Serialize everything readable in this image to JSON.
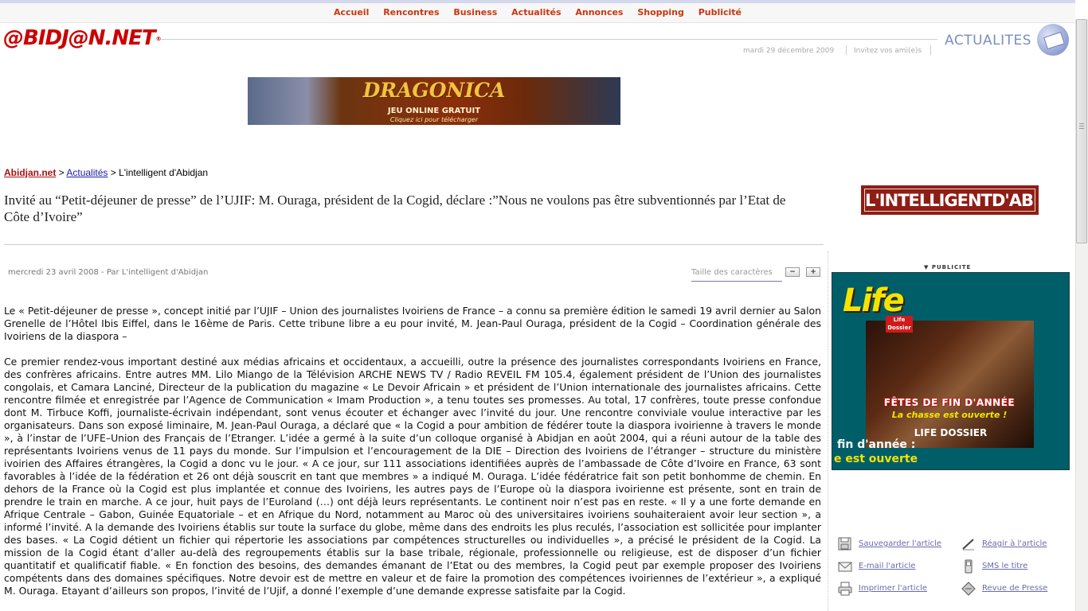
{
  "nav": {
    "items": [
      "Accueil",
      "Rencontres",
      "Business",
      "Actualités",
      "Annonces",
      "Shopping",
      "Publicité"
    ]
  },
  "header": {
    "logo_text": "@BIDJ@N.NET",
    "logo_reg": "®",
    "section": "ACTUALITES",
    "date": "mardi 29 décembre 2009",
    "invite": "Invitez vos ami(e)s"
  },
  "banner": {
    "title": "DRAGONICA",
    "subtitle": "JEU ONLINE GRATUIT",
    "cta": "Cliquez ici pour télécharger"
  },
  "breadcrumb": {
    "home": "Abidjan.net",
    "sep1": " > ",
    "section": "Actualités",
    "sep2": " > ",
    "current": "L'intelligent d'Abidjan"
  },
  "article": {
    "headline": "Invité au “Petit-déjeuner de presse” de l’UJIF: M. Ouraga, président de la Cogid, déclare :”Nous ne voulons pas être subventionnés par l’Etat de Côte d’Ivoire”",
    "dateline": "mercredi 23 avril 2008 - Par L'intelligent d'Abidjan",
    "font_size_label": "Taille des caractères",
    "font_minus": "−",
    "font_plus": "+",
    "paragraphs": [
      "Le « Petit-déjeuner de presse », concept initié par l’UJIF – Union des journalistes Ivoiriens de France – a connu sa première édition le samedi 19 avril dernier au Salon Grenelle de l’Hôtel Ibis Eiffel, dans le 16ème de Paris. Cette tribune libre a eu pour invité, M. Jean-Paul Ouraga, président de la Cogid – Coordination générale des Ivoiriens de la diaspora –",
      "Ce premier rendez-vous important destiné aux médias africains et occidentaux, a accueilli, outre la présence des journalistes correspondants Ivoiriens en France, des confrères africains. Entre autres MM. Lilo Miango de la Télévision ARCHE NEWS TV / Radio REVEIL FM 105.4, également président de l’Union des journalistes congolais, et Camara Lanciné, Directeur de la publication du magazine « Le Devoir Africain » et président de l’Union internationale des journalistes africains. Cette rencontre filmée et enregistrée par l’Agence de Communication « Imam Production », a tenu toutes ses promesses. Au total, 17 confrères, toute presse confondue dont M. Tirbuce Koffi, journaliste-écrivain indépendant, sont venus écouter et échanger avec l’invité du jour. Une rencontre conviviale voulue interactive par les organisateurs. Dans son exposé liminaire, M. Jean-Paul Ouraga, a déclaré que « la Cogid a pour ambition de fédérer toute la diaspora ivoirienne à travers le monde », à l’instar de l’UFE–Union des Français de l’Etranger. L’idée a germé à la suite d’un colloque organisé à Abidjan en août 2004, qui a réuni autour de la table des représentants Ivoiriens venus de 11 pays du monde. Sur l’impulsion et l’encouragement de la DIE – Direction des Ivoiriens de l’étranger – structure du ministère ivoirien des Affaires étrangères, la Cogid a donc vu le jour. « A ce jour, sur 111 associations identifiées auprès de l’ambassade de Côte d’Ivoire en France, 63 sont favorables à l’idée de la fédération et 26 ont déjà souscrit en tant que membres » a indiqué M. Ouraga. L’idée fédératrice fait son petit bonhomme de chemin. En dehors de la France où la Cogid est plus implantée et connue des Ivoiriens, les autres pays de l’Europe où la diaspora ivoirienne est présente, sont en train de prendre le train en marche. A ce jour, huit pays de l’Euroland (…) ont déjà leurs représentants. Le continent noir n’est pas en reste. « Il y a une forte demande en Afrique Centrale – Gabon, Guinée Equatoriale – et en Afrique du Nord, notamment au Maroc où des universitaires ivoiriens souhaiteraient avoir leur section », a informé l’invité. A la demande des Ivoiriens établis sur toute la surface du globe, même dans des endroits les plus reculés, l’association est sollicitée pour implanter des bases. « La Cogid détient un fichier qui répertorie les associations par compétences structurelles ou individuelles », a précisé le président de la Cogid. La mission de la Cogid étant d’aller au-delà des regroupements établis sur la base tribale, régionale, professionnelle ou religieuse, est de disposer d’un fichier quantitatif et qualificatif fiable. « En fonction des besoins, des demandes émanant de l’Etat ou des membres, la Cogid peut par exemple proposer des Ivoiriens compétents dans des domaines spécifiques. Notre devoir est de mettre en valeur et de faire la promotion des compétences ivoiriennes de l’extérieur », a expliqué M. Ouraga. Etayant d’ailleurs son propos, l’invité de l’Ujif, a donné l’exemple d’une demande expresse satisfaite par la Cogid."
    ]
  },
  "sidebar": {
    "paper_logo_a": "L'INTELLIGENT",
    "paper_logo_b": "D'ABIDJAN",
    "pub_label": "▼ PUBLICITE",
    "ad": {
      "brand": "Life",
      "badge": "Life Dossier",
      "fetes": "FÊTES DE FIN D'ANNÉE",
      "chasse": "La chasse est ouverte !",
      "dossier": "LIFE DOSSIER",
      "line1": "fin d'année :",
      "line2": "e est ouverte"
    },
    "tools": {
      "save": "Sauvegarder l'article",
      "react": "Réagir à l'article",
      "email": "E-mail l'article",
      "sms": "SMS le titre",
      "print": "Imprimer l'article",
      "press": "Revue de Presse"
    }
  },
  "colors": {
    "nav_link": "#c8370f",
    "logo_red": "#cc0000",
    "section_blue": "#7a8fbd",
    "tool_link": "#6a6ab2",
    "paper_logo_bg": "#8e1d16",
    "ad_bg": "#005e68"
  }
}
